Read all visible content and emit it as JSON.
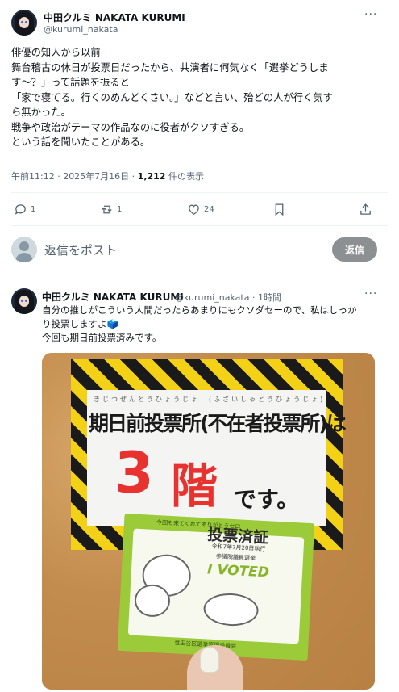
{
  "main_post": {
    "display_name": "中田クルミ NAKATA KURUMI",
    "handle": "@kurumi_nakata",
    "more_icon": "more-dots-icon",
    "lines": [
      "俳優の知人から以前",
      "舞台稽古の休日が投票日だったから、共演者に何気なく「選挙どうしま",
      "す〜？」って話題を振ると",
      "「家で寝てる。行くのめんどくさい。」などと言い、殆どの人が行く気す",
      "ら無かった。",
      "戦争や政治がテーマの作品なのに役者がクソすぎる。",
      "という話を聞いたことがある。"
    ],
    "timestamp": "午前11:12 · 2025年7月16日 · ",
    "views": "1,212",
    "views_suffix": " 件の表示"
  },
  "actions": {
    "reply_count": "1",
    "repost_count": "1",
    "like_count": "24",
    "icons": [
      "reply-icon",
      "repost-icon",
      "like-icon",
      "bookmark-icon",
      "share-icon"
    ]
  },
  "reply_box": {
    "placeholder": "返信をポスト",
    "button_label": "返信"
  },
  "reply_post": {
    "display_name": "中田クルミ NAKATA KURUMI",
    "handle_time": "@kurumi_nakata · 1時間",
    "lines": [
      "自分の推しがこういう人間だったらあまりにもクソダセーので、私はしっか",
      "り投票しますよ🗳️",
      "今回も期日前投票済みです。"
    ]
  },
  "photo": {
    "sign_furigana": "きじつぜんとうひょうじょ　(ふざいしゃとうひょうじょ)",
    "sign_title": "期日前投票所(不在者投票所)は",
    "floor_number": "3",
    "floor_kanji": "階",
    "floor_suffix": "です。",
    "card_top": "今回も来てくれてありがとうセロ",
    "card_title": "投票済証",
    "card_date": "令和7年7月20日執行",
    "card_election": "参議院議員選挙",
    "card_voted": "I VOTED",
    "card_footer": "世田谷区選挙管理委員会"
  }
}
